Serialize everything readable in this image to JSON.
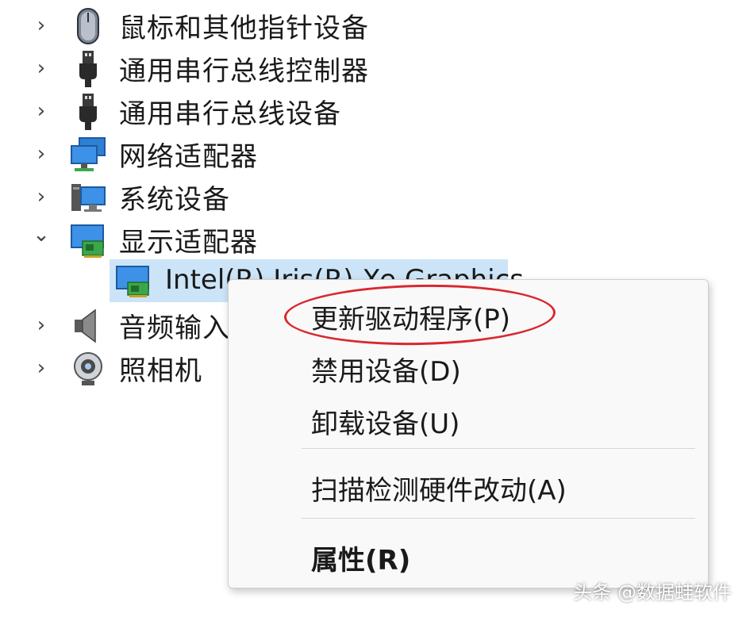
{
  "tree": {
    "items": [
      {
        "label": "鼠标和其他指针设备",
        "expanded": false,
        "icon": "mouse-icon"
      },
      {
        "label": "通用串行总线控制器",
        "expanded": false,
        "icon": "usb-icon"
      },
      {
        "label": "通用串行总线设备",
        "expanded": false,
        "icon": "usb-icon"
      },
      {
        "label": "网络适配器",
        "expanded": false,
        "icon": "network-adapter-icon"
      },
      {
        "label": "系统设备",
        "expanded": false,
        "icon": "system-device-icon"
      },
      {
        "label": "显示适配器",
        "expanded": true,
        "icon": "display-adapter-icon"
      },
      {
        "label": "音频输入",
        "expanded": false,
        "icon": "speaker-icon"
      },
      {
        "label": "照相机",
        "expanded": false,
        "icon": "webcam-icon"
      }
    ],
    "selected_child": {
      "label": "Intel(R) Iris(R) Xe Graphics",
      "icon": "display-adapter-icon"
    },
    "chevron_collapsed": "›",
    "chevron_expanded": "⌄"
  },
  "context_menu": {
    "items": [
      {
        "label": "更新驱动程序(P)",
        "highlighted_by_annotation": true
      },
      {
        "label": "禁用设备(D)"
      },
      {
        "label": "卸载设备(U)"
      },
      {
        "label": "扫描检测硬件改动(A)"
      },
      {
        "label": "属性(R)",
        "bold": true
      }
    ]
  },
  "annotation": {
    "color": "#d9282f",
    "shape": "ellipse"
  },
  "watermark": "头条 @数据蛙软件",
  "colors": {
    "selection": "#cce4f7",
    "menu_bg": "#f9f9f9"
  }
}
